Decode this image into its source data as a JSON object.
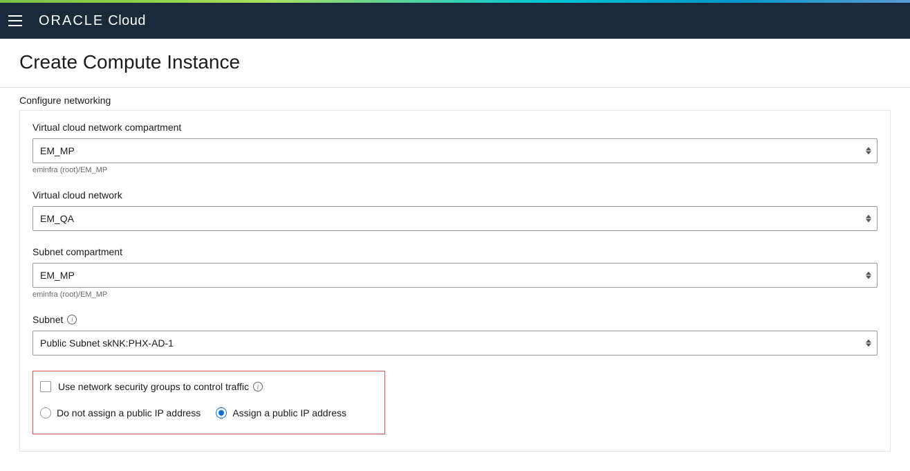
{
  "header": {
    "brand_oracle": "ORACLE",
    "brand_cloud": "Cloud"
  },
  "page": {
    "title": "Create Compute Instance",
    "section_label": "Configure networking"
  },
  "fields": {
    "vcn_compartment": {
      "label": "Virtual cloud network compartment",
      "value": "EM_MP",
      "helper": "eminfra (root)/EM_MP"
    },
    "vcn": {
      "label": "Virtual cloud network",
      "value": "EM_QA"
    },
    "subnet_compartment": {
      "label": "Subnet compartment",
      "value": "EM_MP",
      "helper": "eminfra (root)/EM_MP"
    },
    "subnet": {
      "label": "Subnet",
      "value": "Public Subnet skNK:PHX-AD-1"
    }
  },
  "options": {
    "nsg_checkbox_label": "Use network security groups to control traffic",
    "radio_no_public_ip": "Do not assign a public IP address",
    "radio_assign_public_ip": "Assign a public IP address"
  }
}
